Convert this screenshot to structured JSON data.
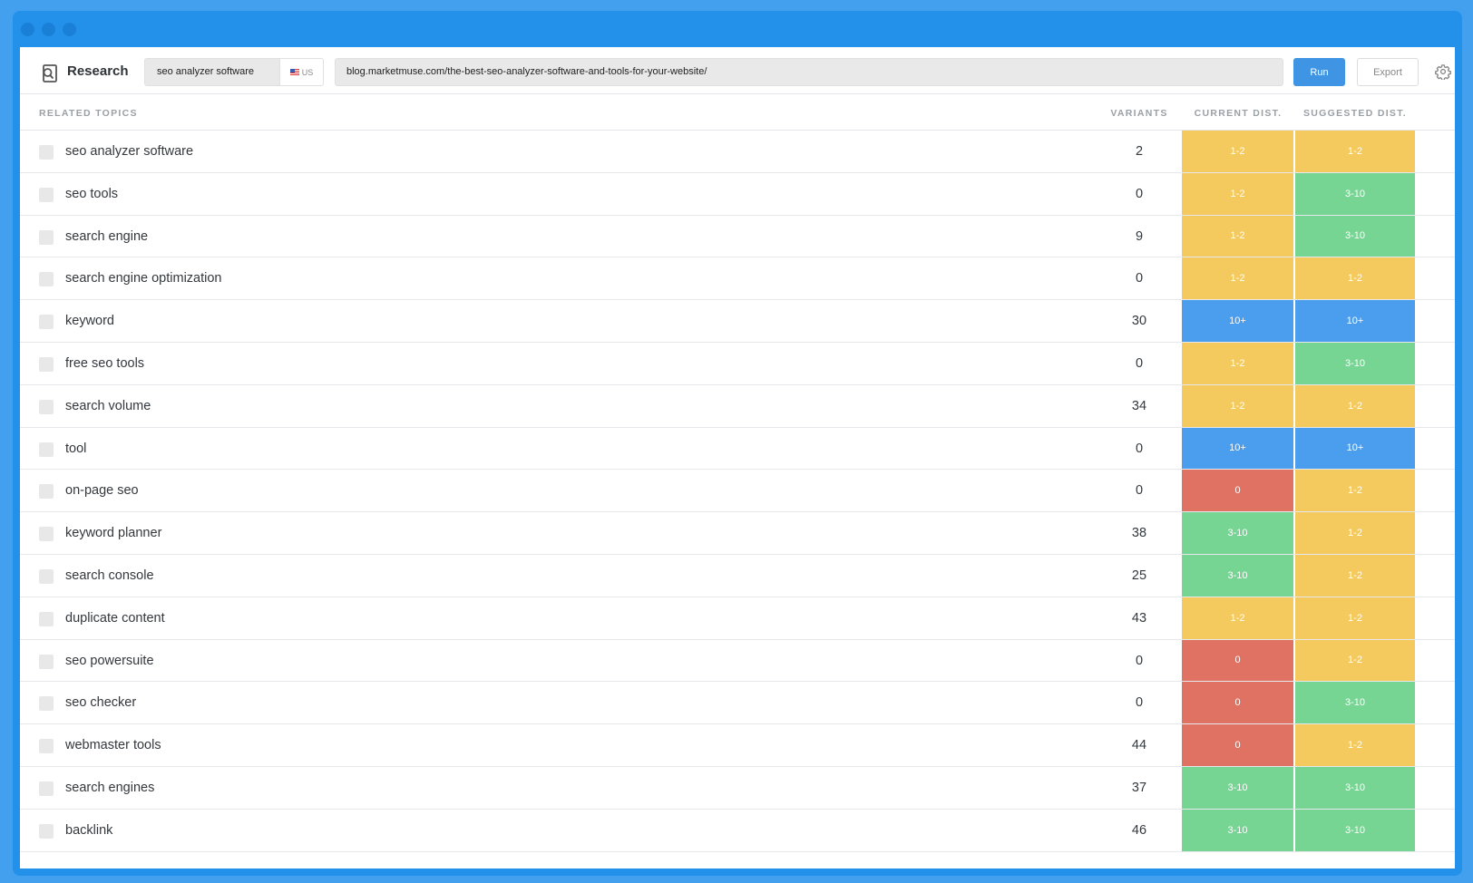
{
  "toolbar": {
    "app_title": "Research",
    "keyword_value": "seo analyzer software",
    "country_code": "US",
    "url_value": "blog.marketmuse.com/the-best-seo-analyzer-software-and-tools-for-your-website/",
    "run_label": "Run",
    "export_label": "Export",
    "logo_icon": "research-doc-icon",
    "settings_icon": "gear-icon"
  },
  "table": {
    "headers": {
      "topic": "RELATED TOPICS",
      "variants": "VARIANTS",
      "current": "CURRENT DIST.",
      "suggested": "SUGGESTED DIST."
    },
    "rows": [
      {
        "topic": "seo analyzer software",
        "variants": "2",
        "current": "1-2",
        "suggested": "1-2"
      },
      {
        "topic": "seo tools",
        "variants": "0",
        "current": "1-2",
        "suggested": "3-10"
      },
      {
        "topic": "search engine",
        "variants": "9",
        "current": "1-2",
        "suggested": "3-10"
      },
      {
        "topic": "search engine optimization",
        "variants": "0",
        "current": "1-2",
        "suggested": "1-2"
      },
      {
        "topic": "keyword",
        "variants": "30",
        "current": "10+",
        "suggested": "10+"
      },
      {
        "topic": "free seo tools",
        "variants": "0",
        "current": "1-2",
        "suggested": "3-10"
      },
      {
        "topic": "search volume",
        "variants": "34",
        "current": "1-2",
        "suggested": "1-2"
      },
      {
        "topic": "tool",
        "variants": "0",
        "current": "10+",
        "suggested": "10+"
      },
      {
        "topic": "on-page seo",
        "variants": "0",
        "current": "0",
        "suggested": "1-2"
      },
      {
        "topic": "keyword planner",
        "variants": "38",
        "current": "3-10",
        "suggested": "1-2"
      },
      {
        "topic": "search console",
        "variants": "25",
        "current": "3-10",
        "suggested": "1-2"
      },
      {
        "topic": "duplicate content",
        "variants": "43",
        "current": "1-2",
        "suggested": "1-2"
      },
      {
        "topic": "seo powersuite",
        "variants": "0",
        "current": "0",
        "suggested": "1-2"
      },
      {
        "topic": "seo checker",
        "variants": "0",
        "current": "0",
        "suggested": "3-10"
      },
      {
        "topic": "webmaster tools",
        "variants": "44",
        "current": "0",
        "suggested": "1-2"
      },
      {
        "topic": "search engines",
        "variants": "37",
        "current": "3-10",
        "suggested": "3-10"
      },
      {
        "topic": "backlink",
        "variants": "46",
        "current": "3-10",
        "suggested": "3-10"
      }
    ]
  },
  "colors": {
    "0": "#e07264",
    "1-2": "#f4c95d",
    "3-10": "#76d593",
    "10+": "#4b9ded",
    "accent": "#3f94e4",
    "frame": "#2391ea"
  }
}
